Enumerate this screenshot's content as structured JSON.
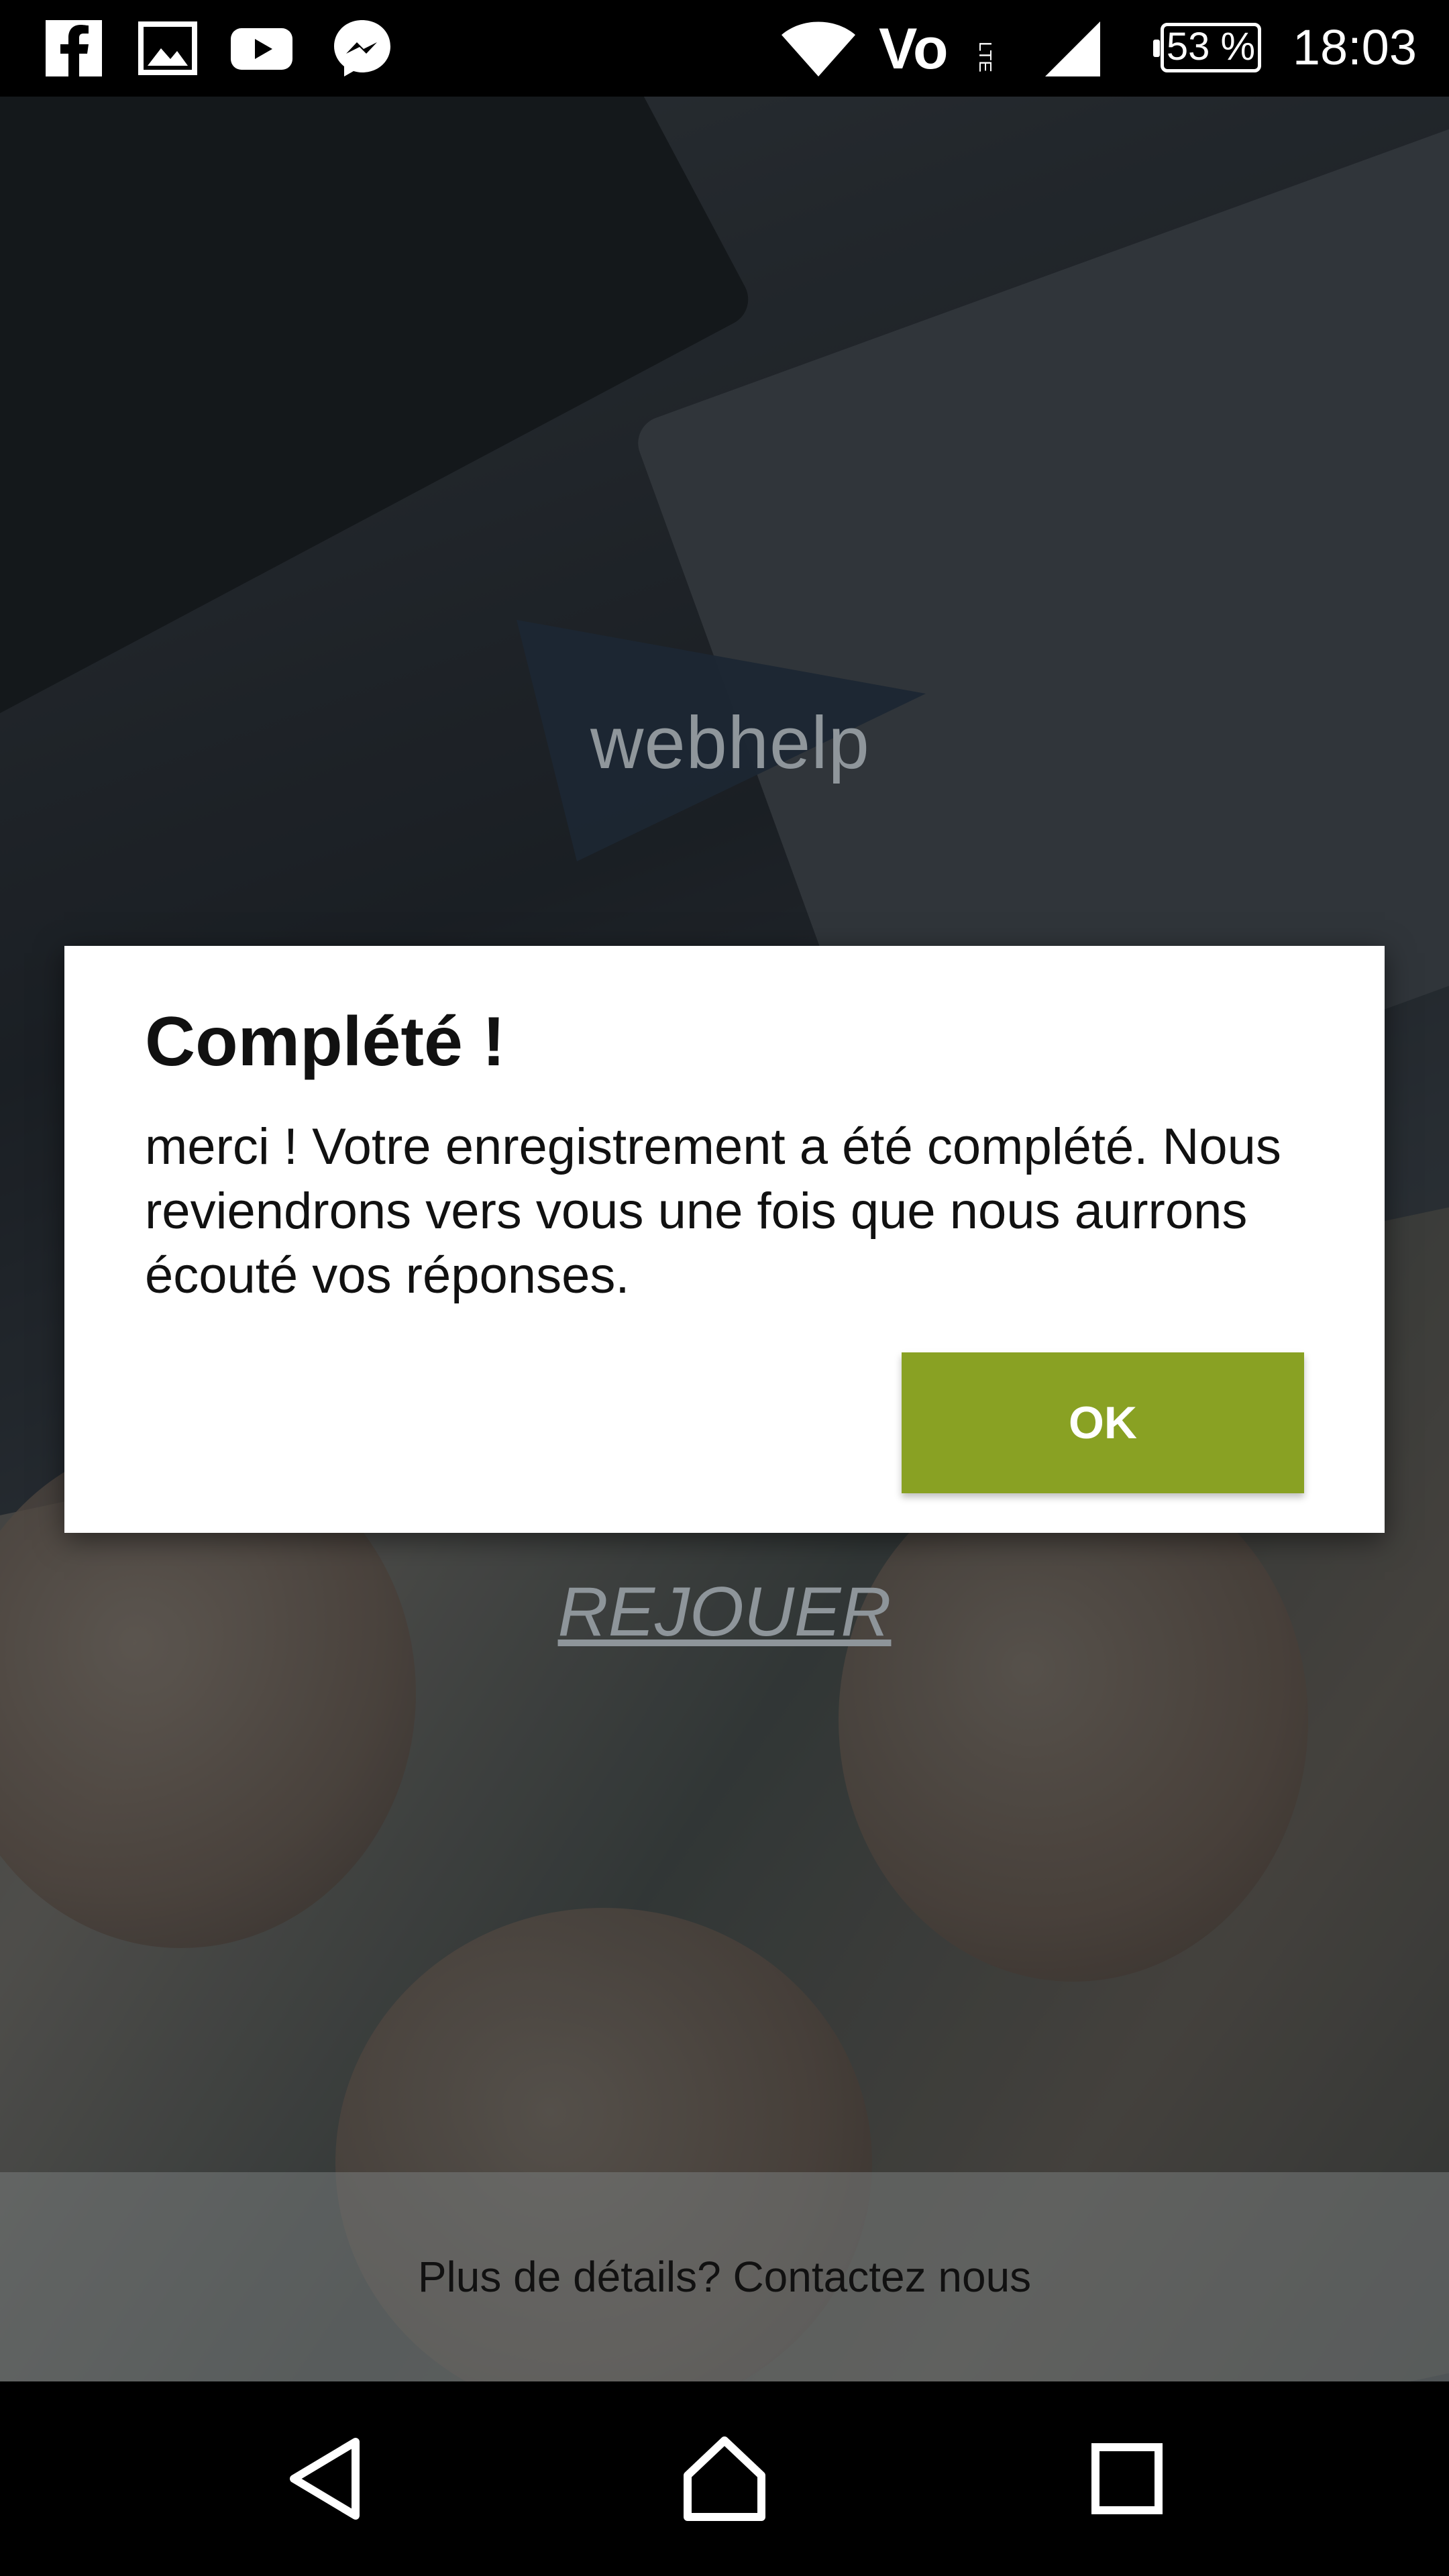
{
  "status_bar": {
    "time": "18:03",
    "battery": "53 %",
    "icons": [
      "facebook-icon",
      "gallery-icon",
      "youtube-icon",
      "messenger-icon",
      "wifi-icon",
      "volte-icon",
      "signal-icon"
    ]
  },
  "app": {
    "logo_text": "webhelp",
    "replay_label": "REJOUER",
    "contact_text": "Plus de détails? Contactez nous"
  },
  "dialog": {
    "title": "Complété !",
    "message": "merci ! Votre enregistrement a été complété. Nous reviendrons vers vous une fois que nous aurrons écouté vos réponses.",
    "ok_label": "OK",
    "ok_color": "#89a123"
  },
  "navbar": {
    "buttons": [
      "back-icon",
      "home-icon",
      "recents-icon"
    ]
  }
}
